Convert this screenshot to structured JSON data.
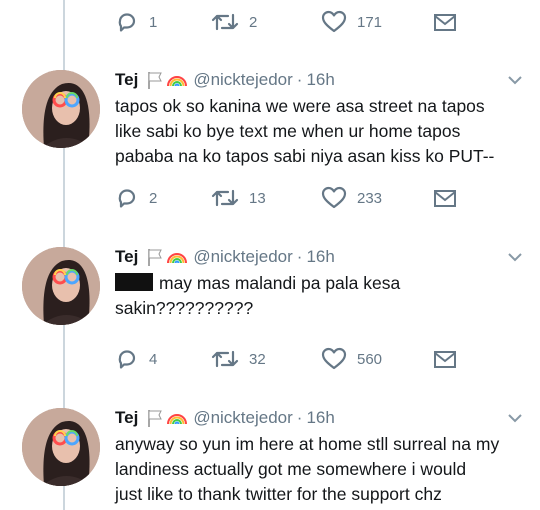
{
  "colors": {
    "text": "#14171a",
    "muted": "#657786",
    "line": "#ccd6dd"
  },
  "top_actions": {
    "reply_count": "1",
    "retweet_count": "2",
    "like_count": "171"
  },
  "tweets": [
    {
      "name": "Tej",
      "handle": "@nicktejedor",
      "separator": "·",
      "time": "16h",
      "lines": [
        "tapos ok so kanina we were asa street na tapos",
        "like sabi ko bye text me when ur home tapos",
        "pababa na ko tapos sabi niya asan kiss ko PUT--"
      ],
      "reply_count": "2",
      "retweet_count": "13",
      "like_count": "233"
    },
    {
      "name": "Tej",
      "handle": "@nicktejedor",
      "separator": "·",
      "time": "16h",
      "lines": [
        "may mas malandi pa pala kesa",
        "sakin??????????"
      ],
      "reply_count": "4",
      "retweet_count": "32",
      "like_count": "560"
    },
    {
      "name": "Tej",
      "handle": "@nicktejedor",
      "separator": "·",
      "time": "16h",
      "lines": [
        "anyway so yun im here at home stll surreal na my",
        "landiness actually got me somewhere i would",
        "just like to thank twitter for the support chz"
      ]
    }
  ],
  "icons": {
    "reply": "reply-bubble-icon",
    "retweet": "retweet-icon",
    "like": "heart-icon",
    "dm": "envelope-icon",
    "menu": "chevron-down-icon",
    "flag": "white-flag-icon",
    "rainbow": "rainbow-icon"
  }
}
